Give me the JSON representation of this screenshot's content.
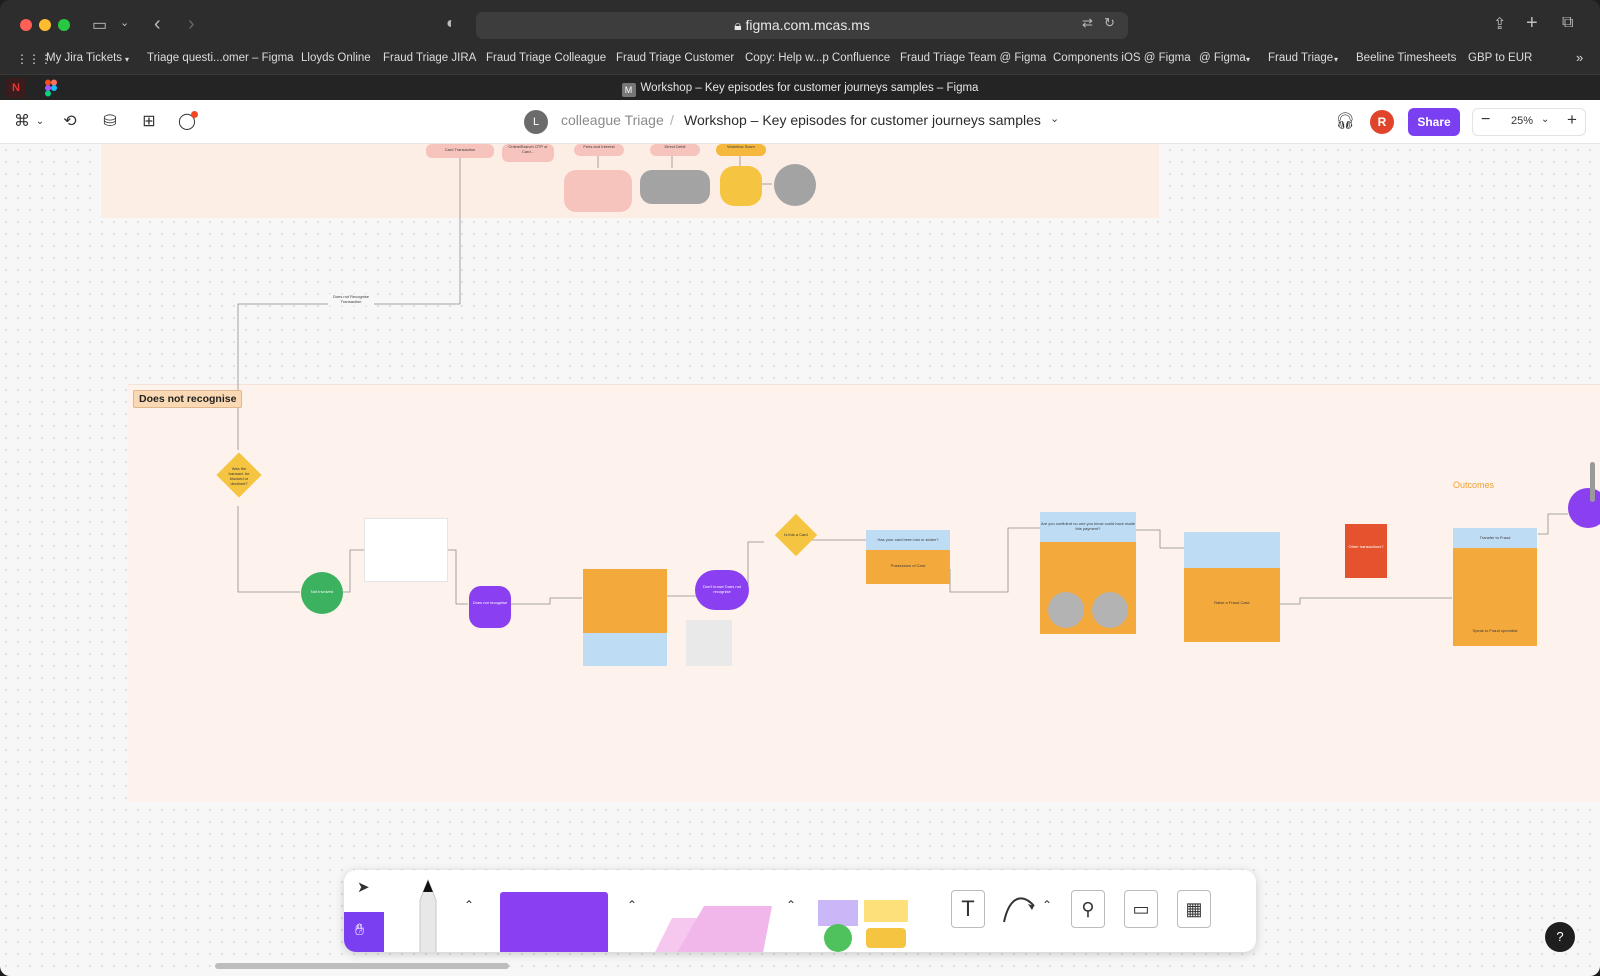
{
  "browser": {
    "url": "figma.com.mcas.ms",
    "tab_title": "Workshop – Key episodes for customer journeys samples – Figma",
    "bookmarks": [
      "My Jira Tickets",
      "Triage questi...omer – Figma",
      "Lloyds Online",
      "Fraud Triage JIRA",
      "Fraud Triage Colleague",
      "Fraud Triage Customer",
      "Copy: Help w...p Confluence",
      "Fraud Triage Team @ Figma",
      "Components iOS @ Figma",
      "@ Figma",
      "Fraud Triage",
      "Beeline Timesheets",
      "GBP to EUR"
    ]
  },
  "figma": {
    "avatar_letter": "L",
    "team": "colleague Triage",
    "separator": "/",
    "file_name": "Workshop – Key episodes for customer journeys samples",
    "user_initial": "R",
    "share_label": "Share",
    "zoom": "25%"
  },
  "canvas": {
    "section_label": "Does not recognise",
    "outcomes_label": "Outcomes",
    "connector_label": "Does not Recognise Transaction",
    "top_nodes": [
      "Card Transaction",
      "Online/Branch OTP or Card...",
      "Fees and Interest",
      "Direct Debit",
      "Workflow Scam"
    ],
    "decision_1": "Was the transact. be blocked or declined?",
    "decision_2": "Is this a Card",
    "node_not_involved": "Not Involved",
    "node_doesnt_recognise": "Does not recognise",
    "node_dont_know": "Don't know/ Does not recognise",
    "node_other": "Other transactions?",
    "node_fraud": "Transfer to Fraud",
    "node_possession": "Possession of Card",
    "node_lost": "Has your card been lost or stolen?",
    "node_confident": "Are you confident no one you know could have made this payment?",
    "node_raise": "Raise a Fraud Case",
    "node_speak": "Speak to Fraud specialist"
  },
  "dock": {
    "tools": [
      "move-tool",
      "hand-tool",
      "marker-tool",
      "shape-tool",
      "sticky-tool",
      "stickers-tool",
      "text-tool",
      "connector-tool",
      "stamp-tool",
      "section-tool",
      "table-tool"
    ],
    "help": "?"
  }
}
